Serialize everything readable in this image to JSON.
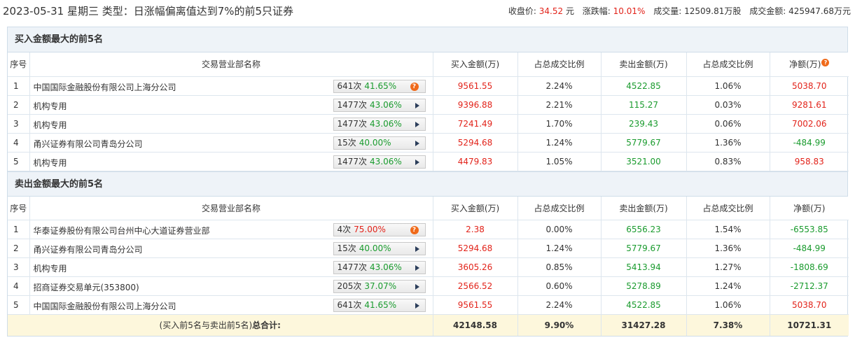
{
  "header": {
    "title": "2023-05-31 星期三 类型：日涨幅偏离值达到7%的前5只证券",
    "close_label": "收盘价:",
    "close_value": "34.52",
    "close_unit": "元",
    "change_label": "涨跌幅:",
    "change_value": "10.01%",
    "volume_label": "成交量:",
    "volume_value": "12509.81万股",
    "turnover_label": "成交金额:",
    "turnover_value": "425947.68万元"
  },
  "columns": [
    "序号",
    "交易营业部名称",
    "买入金额(万)",
    "占总成交比例",
    "卖出金额(万)",
    "占总成交比例",
    "净额(万)"
  ],
  "buy_section": {
    "title": "买入金额最大的前5名",
    "rows": [
      {
        "idx": "1",
        "name": "中国国际金融股份有限公司上海分公司",
        "times": "641次",
        "pct": "41.65%",
        "buy": "9561.55",
        "buy_ratio": "2.24%",
        "sell": "4522.85",
        "sell_ratio": "1.06%",
        "net": "5038.70",
        "icon": "question"
      },
      {
        "idx": "2",
        "name": "机构专用",
        "times": "1477次",
        "pct": "43.06%",
        "buy": "9396.88",
        "buy_ratio": "2.21%",
        "sell": "115.27",
        "sell_ratio": "0.03%",
        "net": "9281.61",
        "icon": "arrow"
      },
      {
        "idx": "3",
        "name": "机构专用",
        "times": "1477次",
        "pct": "43.06%",
        "buy": "7241.49",
        "buy_ratio": "1.70%",
        "sell": "239.43",
        "sell_ratio": "0.06%",
        "net": "7002.06",
        "icon": "arrow"
      },
      {
        "idx": "4",
        "name": "甬兴证券有限公司青岛分公司",
        "times": "15次",
        "pct": "40.00%",
        "buy": "5294.68",
        "buy_ratio": "1.24%",
        "sell": "5779.67",
        "sell_ratio": "1.36%",
        "net": "-484.99",
        "icon": "arrow"
      },
      {
        "idx": "5",
        "name": "机构专用",
        "times": "1477次",
        "pct": "43.06%",
        "buy": "4479.83",
        "buy_ratio": "1.05%",
        "sell": "3521.00",
        "sell_ratio": "0.83%",
        "net": "958.83",
        "icon": "arrow"
      }
    ]
  },
  "sell_section": {
    "title": "卖出金额最大的前5名",
    "rows": [
      {
        "idx": "1",
        "name": "华泰证券股份有限公司台州中心大道证券营业部",
        "times": "4次",
        "pct": "75.00%",
        "buy": "2.38",
        "buy_ratio": "0.00%",
        "sell": "6556.23",
        "sell_ratio": "1.54%",
        "net": "-6553.85",
        "icon": "question"
      },
      {
        "idx": "2",
        "name": "甬兴证券有限公司青岛分公司",
        "times": "15次",
        "pct": "40.00%",
        "buy": "5294.68",
        "buy_ratio": "1.24%",
        "sell": "5779.67",
        "sell_ratio": "1.36%",
        "net": "-484.99",
        "icon": "arrow"
      },
      {
        "idx": "3",
        "name": "机构专用",
        "times": "1477次",
        "pct": "43.06%",
        "buy": "3605.26",
        "buy_ratio": "0.85%",
        "sell": "5413.94",
        "sell_ratio": "1.27%",
        "net": "-1808.69",
        "icon": "arrow"
      },
      {
        "idx": "4",
        "name": "招商证券交易单元(353800)",
        "times": "205次",
        "pct": "37.07%",
        "buy": "2566.52",
        "buy_ratio": "0.60%",
        "sell": "5278.89",
        "sell_ratio": "1.24%",
        "net": "-2712.37",
        "icon": "arrow"
      },
      {
        "idx": "5",
        "name": "中国国际金融股份有限公司上海分公司",
        "times": "641次",
        "pct": "41.65%",
        "buy": "9561.55",
        "buy_ratio": "2.24%",
        "sell": "4522.85",
        "sell_ratio": "1.06%",
        "net": "5038.70",
        "icon": "arrow"
      }
    ]
  },
  "summary": {
    "label_prefix": "(买入前5名与卖出前5名)",
    "label_bold": "总合计:",
    "buy": "42148.58",
    "buy_ratio": "9.90%",
    "sell": "31427.28",
    "sell_ratio": "7.38%",
    "net": "10721.31"
  },
  "colors": {
    "up": "#e2231a",
    "down": "#1a9b2e",
    "header_bg": "#eef3f8",
    "summary_bg": "#fdf7dc"
  }
}
